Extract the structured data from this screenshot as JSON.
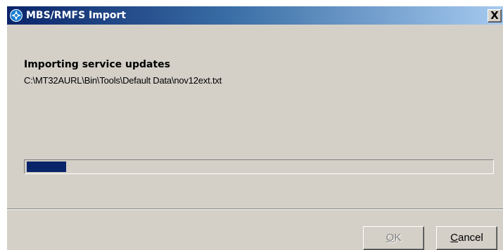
{
  "window": {
    "title": "MBS/RMFS Import",
    "close_label": "X"
  },
  "status": {
    "heading": "Importing service updates",
    "file_path": "C:\\MT32AURL\\Bin\\Tools\\Default Data\\nov12ext.txt"
  },
  "progress": {
    "fraction": 0.085,
    "fill_color": "#0a246a"
  },
  "buttons": {
    "ok": {
      "accel": "O",
      "rest": "K",
      "enabled": false
    },
    "cancel": {
      "accel": "C",
      "rest": "ancel",
      "enabled": true
    }
  },
  "icons": {
    "app": "app-logo-icon",
    "close": "close-icon"
  },
  "colors": {
    "title_bar": "#0a246a",
    "window_face": "#d4d0c8"
  }
}
